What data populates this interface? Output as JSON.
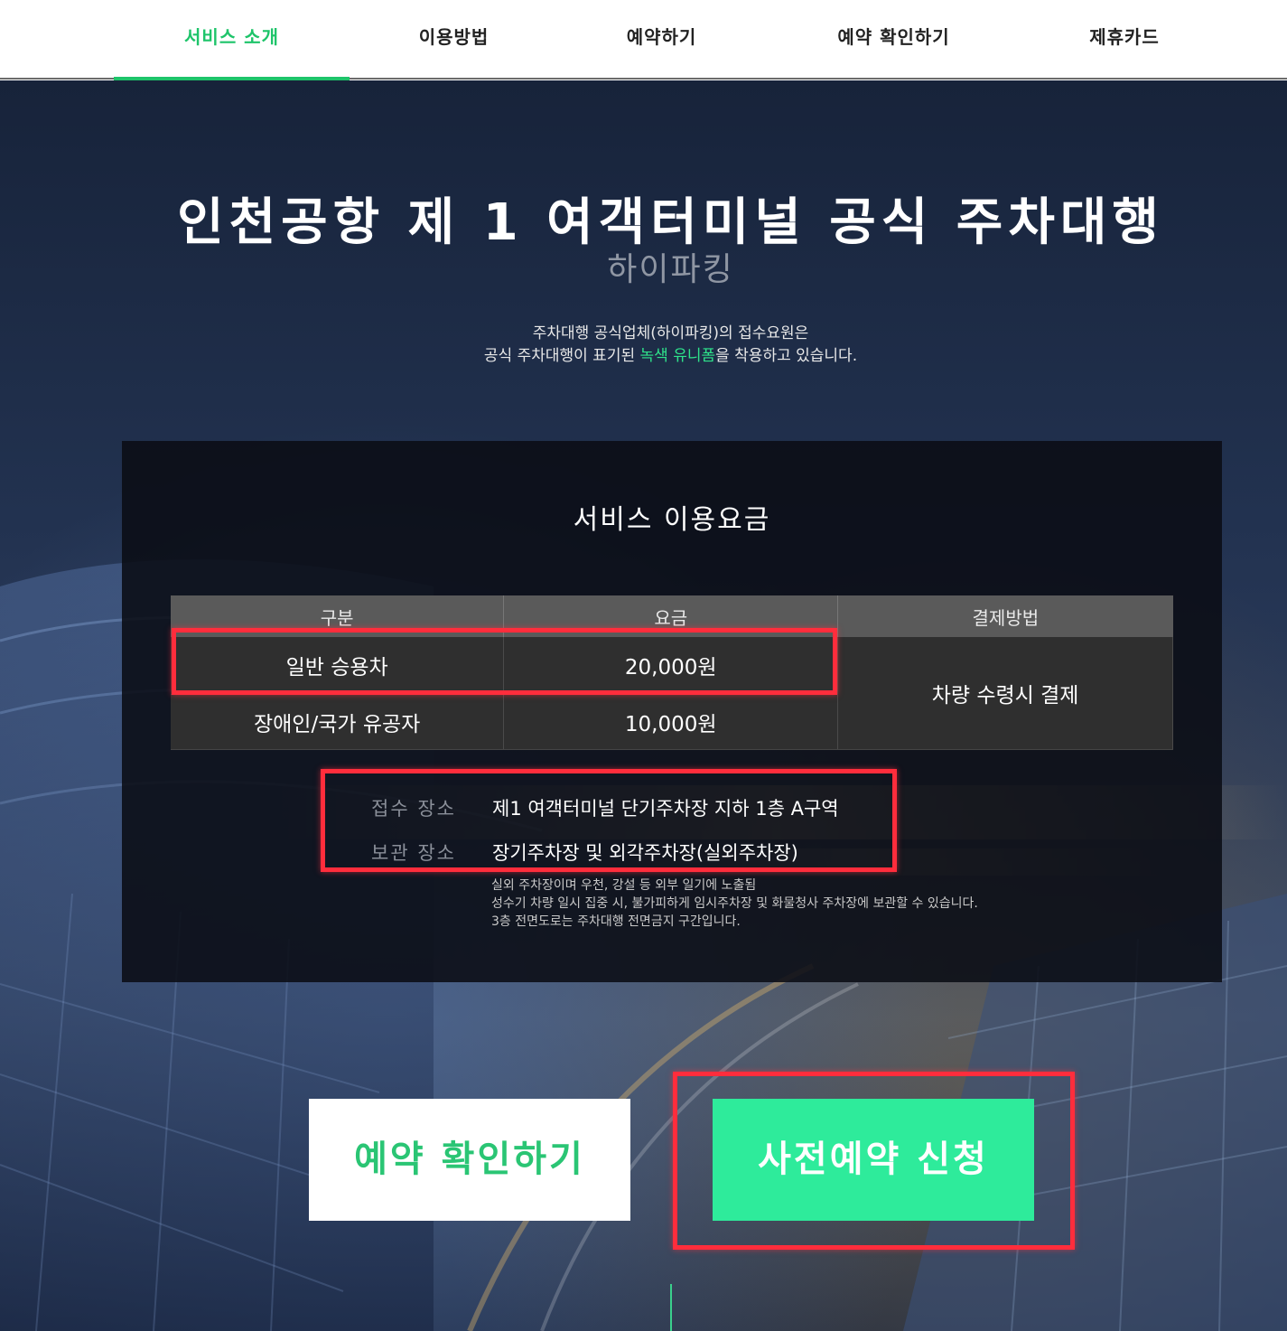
{
  "nav": {
    "items": [
      {
        "label": "서비스 소개",
        "active": true
      },
      {
        "label": "이용방법",
        "active": false
      },
      {
        "label": "예약하기",
        "active": false
      },
      {
        "label": "예약 확인하기",
        "active": false
      },
      {
        "label": "제휴카드",
        "active": false
      }
    ]
  },
  "hero": {
    "title": "인천공항 제 1 여객터미널 공식 주차대행",
    "subtitle": "하이파킹",
    "desc_line1": "주차대행 공식업체(하이파킹)의 접수요원은",
    "desc_line2_a": "공식 주차대행이 표기된 ",
    "desc_line2_highlight": "녹색 유니폼",
    "desc_line2_b": "을 착용하고 있습니다."
  },
  "pricing": {
    "title": "서비스 이용요금",
    "headers": [
      "구분",
      "요금",
      "결제방법"
    ],
    "rows": [
      {
        "type": "일반 승용차",
        "price": "20,000원"
      },
      {
        "type": "장애인/국가 유공자",
        "price": "10,000원"
      }
    ],
    "payment": "차량 수령시 결제",
    "reception_label": "접수 장소",
    "reception_value": "제1 여객터미널 단기주차장 지하 1층 A구역",
    "storage_label": "보관 장소",
    "storage_value": "장기주차장 및 외각주차장(실외주차장)",
    "notes": [
      "실외 주차장이며 우천, 강설 등 외부 일기에 노출됨",
      "성수기 차량 일시 집중 시, 불가피하게 임시주차장 및 화물청사 주차장에 보관할 수 있습니다.",
      "3층 전면도로는 주차대행 전면금지 구간입니다."
    ]
  },
  "buttons": {
    "check": "예약 확인하기",
    "reserve": "사전예약 신청"
  },
  "colors": {
    "accent_green": "#1ec46a",
    "button_green": "#2eeb9b",
    "highlight_red": "#ff2d3c"
  }
}
